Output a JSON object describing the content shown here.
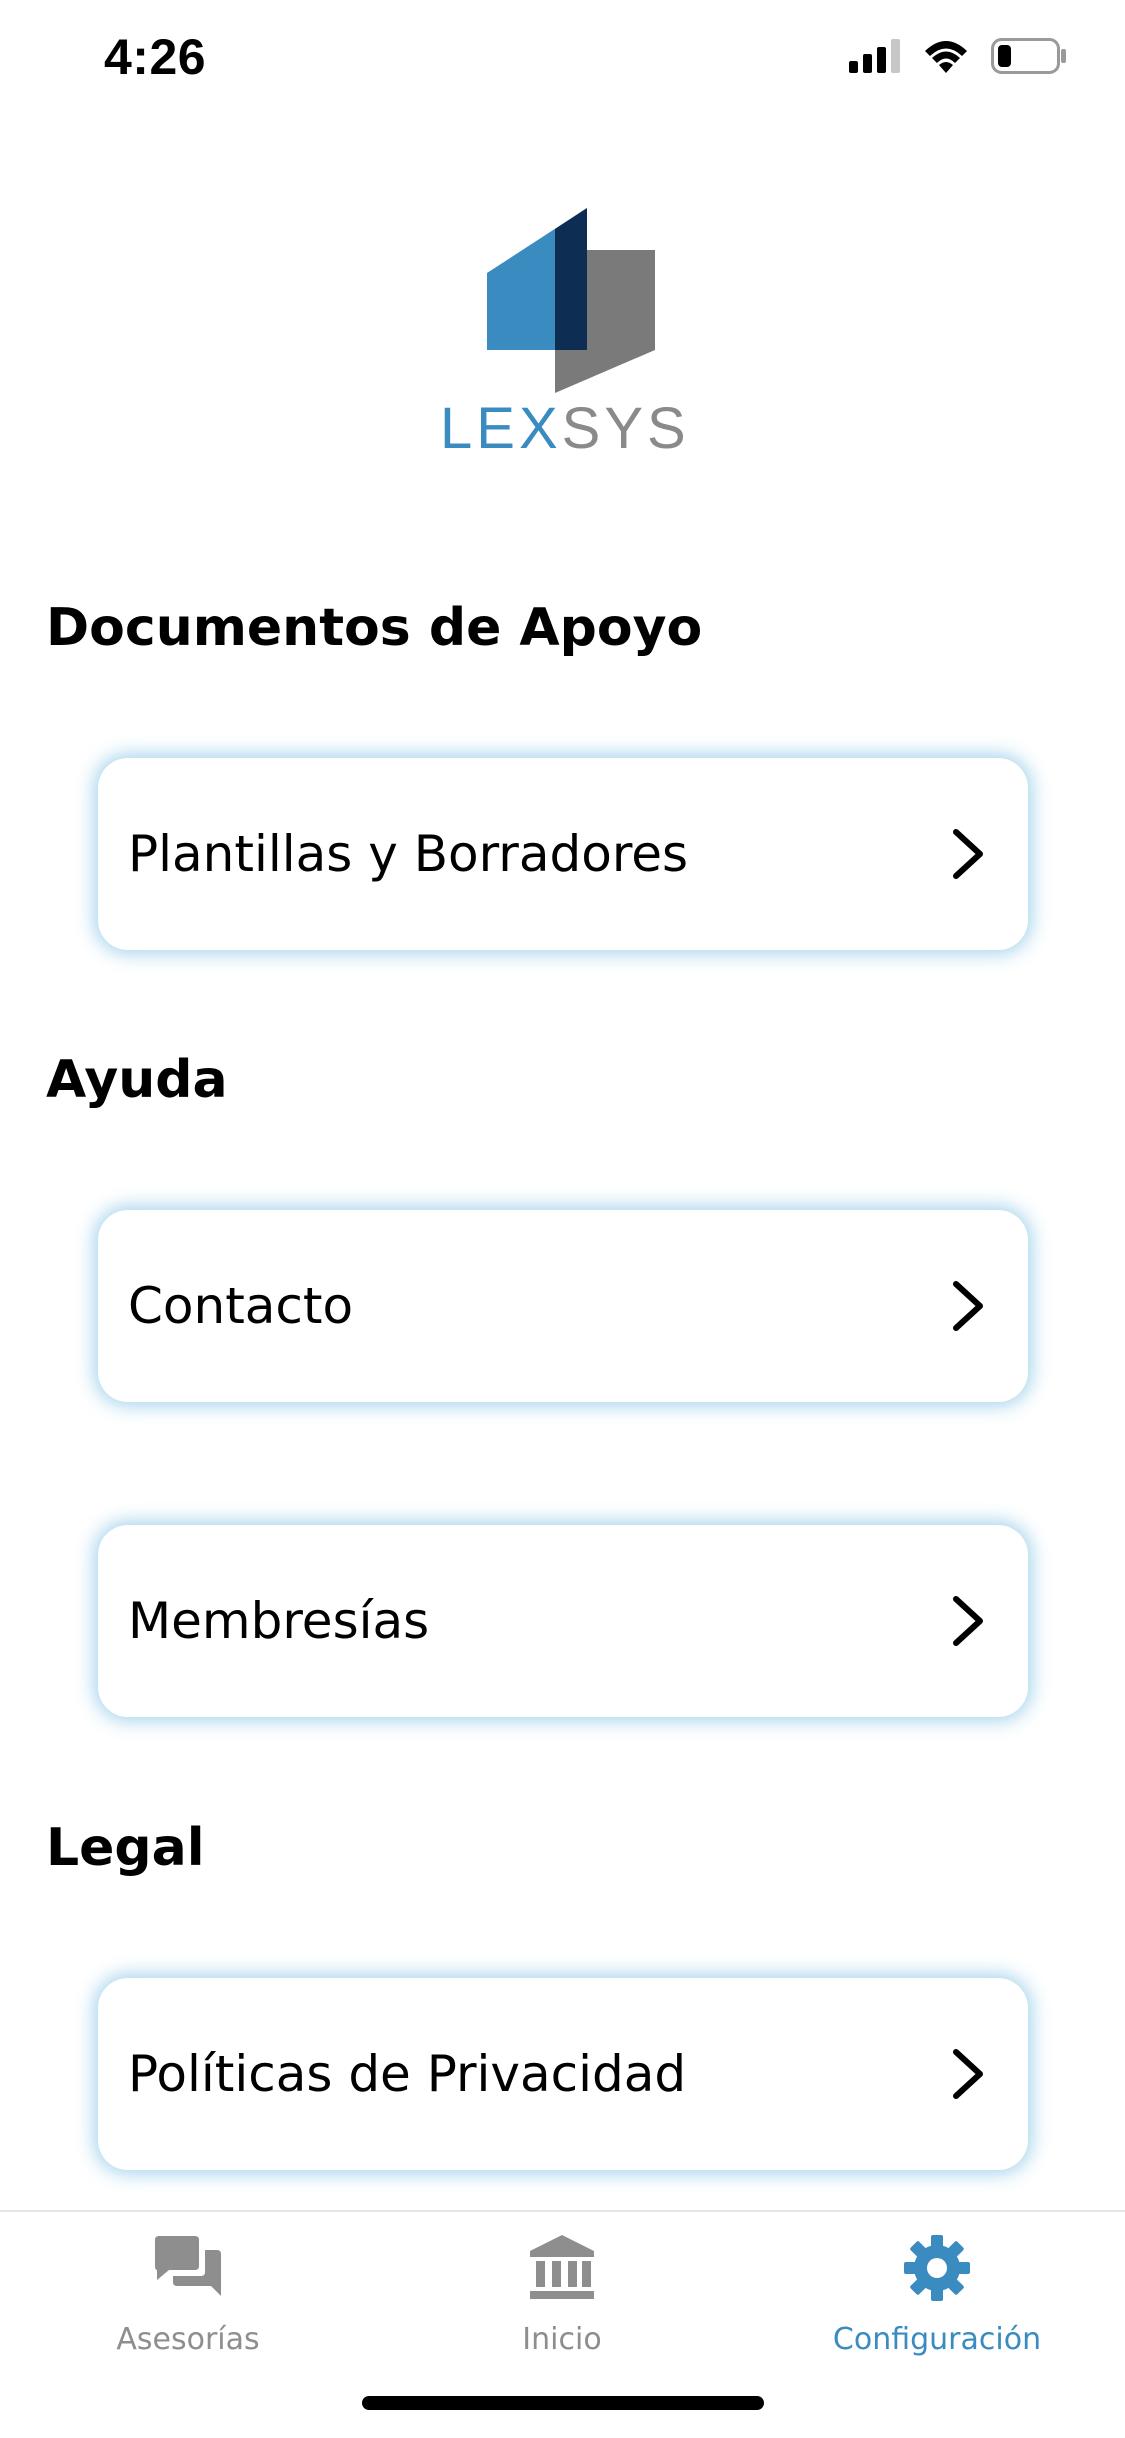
{
  "status_bar": {
    "time": "4:26",
    "icons": [
      "cellular-signal-icon",
      "wifi-icon",
      "battery-icon"
    ],
    "battery_level": 0.2
  },
  "logo": {
    "text_part1": "LEX",
    "text_part2": "SYS",
    "colors": {
      "blue": "#3a8bbf",
      "dark": "#0d2d52",
      "gray": "#7a7a7a"
    }
  },
  "sections": {
    "support": {
      "title": "Documentos de Apoyo",
      "items": [
        {
          "label": "Plantillas y Borradores",
          "icon": "chevron-right-icon"
        }
      ]
    },
    "help": {
      "title": "Ayuda",
      "items": [
        {
          "label": "Contacto",
          "icon": "chevron-right-icon"
        },
        {
          "label": "Membresías",
          "icon": "chevron-right-icon"
        }
      ]
    },
    "legal": {
      "title": "Legal",
      "items": [
        {
          "label": "Políticas de Privacidad",
          "icon": "chevron-right-icon"
        }
      ]
    }
  },
  "tab_bar": {
    "tabs": [
      {
        "label": "Asesorías",
        "icon": "chat-bubbles-icon",
        "active": false
      },
      {
        "label": "Inicio",
        "icon": "bank-building-icon",
        "active": false
      },
      {
        "label": "Configuración",
        "icon": "gear-icon",
        "active": true
      }
    ],
    "colors": {
      "active": "#3a8bbf",
      "inactive": "#8e8e8e"
    }
  }
}
